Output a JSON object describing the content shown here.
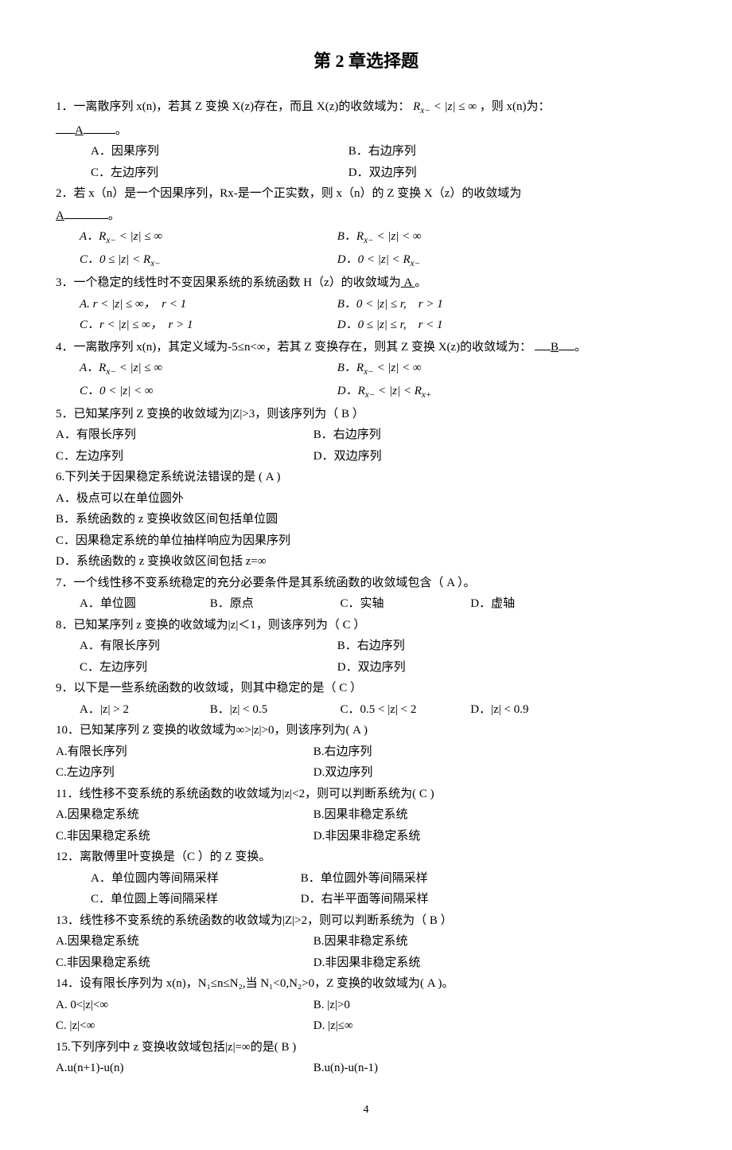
{
  "title": "第 2 章选择题",
  "pagenum": "4",
  "q1": {
    "stem_a": "1．一离散序列 x(n)，若其 Z 变换 X(z)存在，而且 X(z)的收敛域为：",
    "math": "R x− < |z| ≤ ∞",
    "stem_b": "，则 x(n)为：",
    "ans": "A",
    "period": "。",
    "A": "A．因果序列",
    "B": "B．右边序列",
    "C": "C．左边序列",
    "D": "D．双边序列"
  },
  "q2": {
    "stem": "2．若 x（n）是一个因果序列，Rx-是一个正实数，则 x（n）的 Z 变换 X（z）的收敛域为",
    "ans": "A",
    "period": "。",
    "A": "A．R x− < |z| ≤ ∞",
    "B": "B．R x− < |z| < ∞",
    "C": "C．0 ≤ |z| < R x−",
    "D": "D．0 < |z| < R x−"
  },
  "q3": {
    "stem": "3．一个稳定的线性时不变因果系统的系统函数 H（z）的收敛域为",
    "ans": " A ",
    "period": "。",
    "A": "A. r < |z| ≤ ∞，  r < 1",
    "B": "B．0 < |z| ≤ r,    r > 1",
    "C": "C．r < |z| ≤ ∞，  r > 1",
    "D": "D．0 ≤ |z| ≤ r,    r < 1"
  },
  "q4": {
    "stem_a": "4．一离散序列 x(n)，其定义域为-5≤n<∞，若其 Z 变换存在，则其 Z 变换 X(z)的收敛域为：",
    "ans": "B",
    "period": "。",
    "A": "A．R x− < |z| ≤ ∞",
    "B": "B．R x− < |z| < ∞",
    "C": "C．0 < |z| < ∞",
    "D": "D．R x− < |z| < R x+"
  },
  "q5": {
    "stem": "5．已知某序列 Z 变换的收敛域为|Z|>3，则该序列为（    B        ）",
    "A": "A．有限长序列",
    "B": "B．右边序列",
    "C": "C．左边序列",
    "D": "D．双边序列"
  },
  "q6": {
    "stem": "6.下列关于因果稳定系统说法错误的是                            (     A     )",
    "A": "A．极点可以在单位圆外",
    "B": "B．系统函数的 z 变换收敛区间包括单位圆",
    "C": "C．因果稳定系统的单位抽样响应为因果序列",
    "D": "D．系统函数的 z 变换收敛区间包括 z=∞"
  },
  "q7": {
    "stem": "7．一个线性移不变系统稳定的充分必要条件是其系统函数的收敛域包含（ A    ）。",
    "A": "A．单位圆",
    "B": "B．原点",
    "C": "C．实轴",
    "D": "D．虚轴"
  },
  "q8": {
    "stem": "8．已知某序列 z 变换的收敛域为|z|＜1，则该序列为（    C       ）",
    "A": "A．有限长序列",
    "B": "B．右边序列",
    "C": "C．左边序列",
    "D": "D．双边序列"
  },
  "q9": {
    "stem": "9．以下是一些系统函数的收敛域，则其中稳定的是（    C       ）",
    "A": "A．|z| > 2",
    "B": "B．|z| < 0.5",
    "C": "C．0.5 < |z| < 2",
    "D": "D．|z| < 0.9"
  },
  "q10": {
    "stem": "10．已知某序列 Z 变换的收敛域为∞>|z|>0，则该序列为(     A        )",
    "A": "A.有限长序列",
    "B": "B.右边序列",
    "C": "C.左边序列",
    "D": "D.双边序列"
  },
  "q11": {
    "stem": "11．线性移不变系统的系统函数的收敛域为|z|<2，则可以判断系统为(      C      )",
    "A": "A.因果稳定系统",
    "B": "B.因果非稳定系统",
    "C": "C.非因果稳定系统",
    "D": "D.非因果非稳定系统"
  },
  "q12": {
    "stem": "12．离散傅里叶变换是（C ）的 Z 变换。",
    "A": "A．单位圆内等间隔采样",
    "B": "B．单位圆外等间隔采样",
    "C": "C．单位圆上等间隔采样",
    "D": "D．右半平面等间隔采样"
  },
  "q13": {
    "stem": "13．线性移不变系统的系统函数的收敛域为|Z|>2，则可以判断系统为（    B       ）",
    "A": "A.因果稳定系统",
    "B": "B.因果非稳定系统",
    "C": "C.非因果稳定系统",
    "D": "D.非因果非稳定系统"
  },
  "q14": {
    "stem": "14．设有限长序列为 x(n)，N₁≤n≤N₂,当 N₁<0,N₂>0，Z 变换的收敛域为(     A       )。",
    "A": "A. 0<|z|<∞",
    "B": "B. |z|>0",
    "C": "C. |z|<∞",
    "D": "D. |z|≤∞"
  },
  "q15": {
    "stem": "15.下列序列中 z 变换收敛域包括|z|=∞的是(      B      )",
    "A": "A.u(n+1)-u(n)",
    "B": "B.u(n)-u(n-1)"
  }
}
